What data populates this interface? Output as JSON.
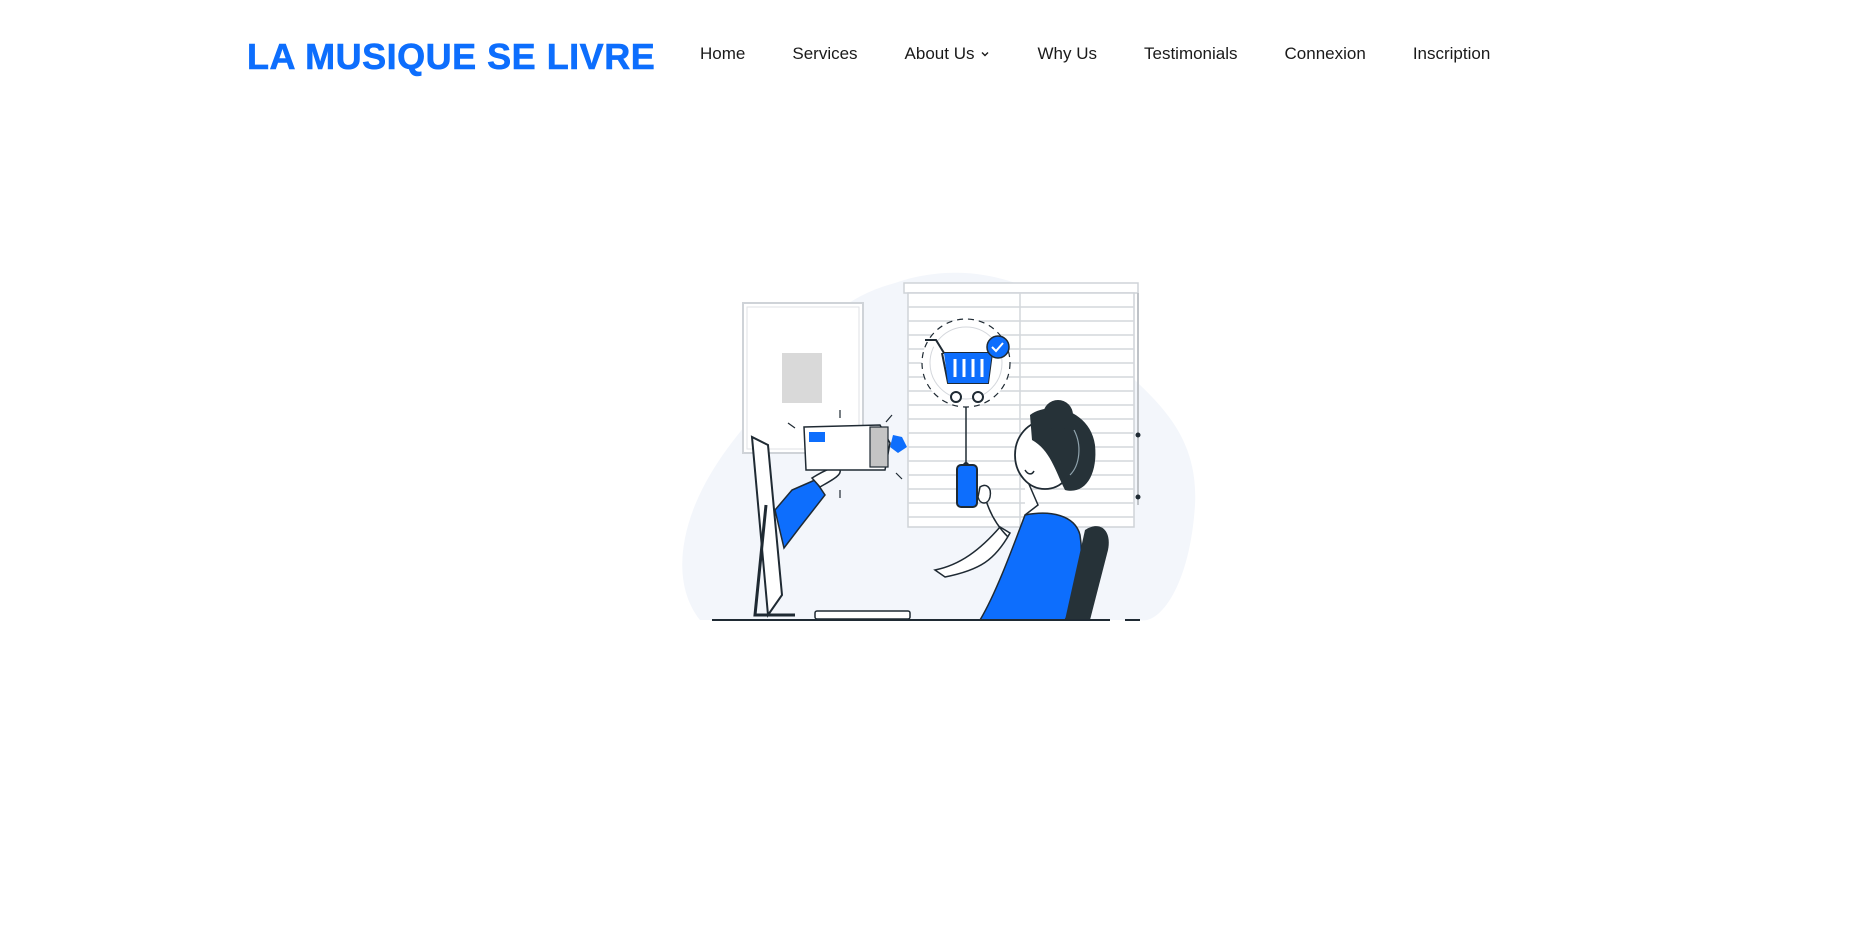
{
  "brand": {
    "logo_text": "LA MUSIQUE SE LIVRE",
    "accent_color": "#0d6efd"
  },
  "nav": {
    "items": [
      {
        "label": "Home"
      },
      {
        "label": "Services"
      },
      {
        "label": "About Us",
        "has_dropdown": true,
        "icon": "chevron-down-icon"
      },
      {
        "label": "Why Us"
      },
      {
        "label": "Testimonials"
      },
      {
        "label": "Connexion"
      },
      {
        "label": "Inscription"
      }
    ]
  },
  "hero": {
    "illustration": "online-shopping-illustration"
  }
}
